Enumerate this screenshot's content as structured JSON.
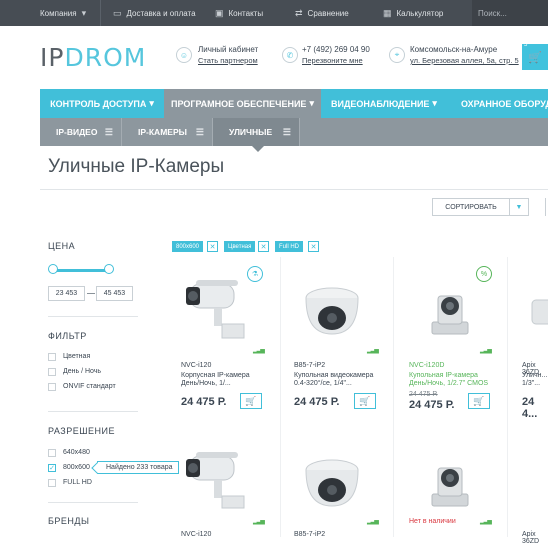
{
  "topbar": {
    "items": [
      "Компания",
      "Доставка и оплата",
      "Контакты",
      "Сравнение",
      "Калькулятор"
    ],
    "search_placeholder": "Поиск..."
  },
  "logo": {
    "ip": "IP",
    "drom": "DROM"
  },
  "header": {
    "account_title": "Личный кабинет",
    "account_link": "Стать партнером",
    "phone": "+7 (492) 269 04 90",
    "phone_link": "Перезвоните мне",
    "city": "Комсомольск-на-Амуре",
    "address": "ул. Березовая аллея, 5а, стр. 5",
    "cart_count": "5"
  },
  "catnav": [
    "КОНТРОЛЬ ДОСТУПА",
    "ПРОГРАМНОЕ ОБЕСПЕЧЕНИЕ",
    "ВИДЕОНАБЛЮДЕНИЕ",
    "ОХРАННОЕ ОБОРУДОВАНИЕ"
  ],
  "subnav": [
    "IP-ВИДЕО",
    "IP-КАМЕРЫ",
    "УЛИЧНЫЕ"
  ],
  "page_title": "Уличные IP-Камеры",
  "sort_label": "СОРТИРОВАТЬ",
  "filters": {
    "price_title": "ЦЕНА",
    "price_min": "23 453",
    "price_max": "45 453",
    "filter_title": "ФИЛЬТР",
    "filter_items": [
      "Цветная",
      "День / Ночь",
      "ONVIF стандарт"
    ],
    "resolution_title": "РАЗРЕШЕНИЕ",
    "resolution_items": [
      "640x480",
      "800x600",
      "FULL HD"
    ],
    "found_text": "Найдено 233 товара",
    "brands_title": "БРЕНДЫ"
  },
  "chips": [
    "800x600",
    "Цветная",
    "Full HD"
  ],
  "products": [
    {
      "model": "NVC-i120",
      "desc1": "Корпусная  IP-камера",
      "desc2": "День/Ночь, 1/...",
      "price": "24 475 Р.",
      "old": ""
    },
    {
      "model": "B85-7-iP2",
      "desc1": "Купольная видеокамера",
      "desc2": "0.4-320°/се, 1/4\"...",
      "price": "24 475 Р.",
      "old": ""
    },
    {
      "model": "NVC-i120D",
      "desc1": "Купольная IP-камера",
      "desc2": "День/Ночь, 1/2.7\" CMOS",
      "price": "24 475 Р.",
      "old": "24 475 Р."
    },
    {
      "model": "Apix 36ZD",
      "desc1": "Уличн...",
      "desc2": "1/3\"...",
      "price": "24 4...",
      "old": ""
    }
  ],
  "row2": [
    {
      "model": "NVC-i120"
    },
    {
      "model": "B85-7-iP2"
    },
    {
      "model": "Нет в наличии"
    },
    {
      "model": "Apix 36ZD"
    }
  ]
}
